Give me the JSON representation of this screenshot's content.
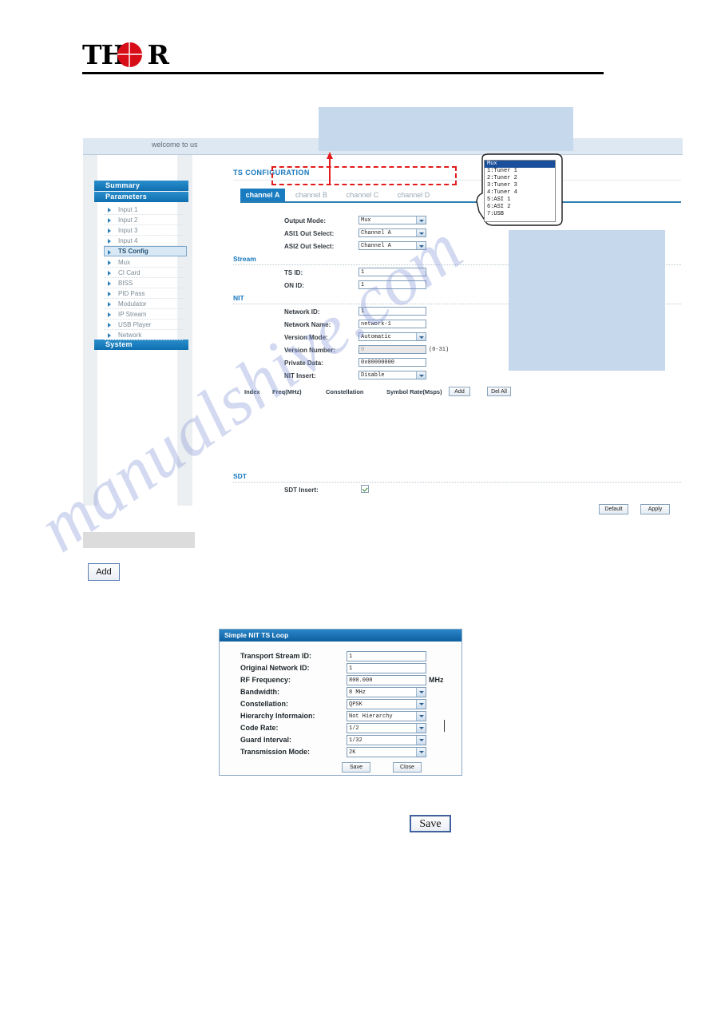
{
  "logo": {
    "text_left": "TH",
    "text_right": "R",
    "globe_icon": "globe-icon"
  },
  "window": {
    "welcome_text": "welcome to us"
  },
  "sidebar": {
    "headers": [
      {
        "label": "Summary"
      },
      {
        "label": "Parameters"
      },
      {
        "label": "System"
      }
    ],
    "items": [
      {
        "label": "Input 1"
      },
      {
        "label": "Input 2"
      },
      {
        "label": "Input 3"
      },
      {
        "label": "Input 4"
      },
      {
        "label": "TS Config"
      },
      {
        "label": "Mux"
      },
      {
        "label": "CI Card"
      },
      {
        "label": "BISS"
      },
      {
        "label": "PID Pass"
      },
      {
        "label": "Modulator"
      },
      {
        "label": "IP Stream"
      },
      {
        "label": "USB Player"
      },
      {
        "label": "Network"
      }
    ],
    "active_item": "TS Config"
  },
  "main": {
    "page_title": "TS CONFIGURATION",
    "tabs": [
      {
        "label": "channel A",
        "active": true
      },
      {
        "label": "channel B",
        "active": false
      },
      {
        "label": "channel C",
        "active": false
      },
      {
        "label": "channel D",
        "active": false
      }
    ],
    "output": {
      "output_mode_label": "Output Mode:",
      "output_mode_value": "Mux",
      "asi1_label": "ASI1 Out Select:",
      "asi1_value": "Channel A",
      "asi2_label": "ASI2 Out Select:",
      "asi2_value": "Channel A"
    },
    "stream": {
      "section": "Stream",
      "ts_id_label": "TS ID:",
      "ts_id_value": "1",
      "on_id_label": "ON ID:",
      "on_id_value": "1"
    },
    "nit": {
      "section": "NIT",
      "network_id_label": "Network ID:",
      "network_id_value": "1",
      "network_name_label": "Network Name:",
      "network_name_value": "network-1",
      "version_mode_label": "Version Mode:",
      "version_mode_value": "Automatic",
      "version_number_label": "Version Number:",
      "version_number_value": "0",
      "version_number_hint": "(0-31)",
      "private_data_label": "Private Data:",
      "private_data_value": "0x00000000",
      "nit_insert_label": "NIT Insert:",
      "nit_insert_value": "Disable"
    },
    "nit_table": {
      "columns": [
        "Index",
        "Freq(MHz)",
        "Constellation",
        "Symbol Rate(Msps)"
      ],
      "add_button": "Add",
      "delall_button": "Del All",
      "rows": []
    },
    "sdt": {
      "section": "SDT",
      "sdt_insert_label": "SDT Insert:",
      "sdt_insert_checked": true
    },
    "footer": {
      "default_button": "Default",
      "apply_button": "Apply"
    }
  },
  "dropdown_callout": {
    "options": [
      {
        "label": "Mux",
        "selected": true
      },
      {
        "label": "1:Tuner 1",
        "selected": false
      },
      {
        "label": "2:Tuner 2",
        "selected": false
      },
      {
        "label": "3:Tuner 3",
        "selected": false
      },
      {
        "label": "4:Tuner 4",
        "selected": false
      },
      {
        "label": "5:ASI 1",
        "selected": false
      },
      {
        "label": "6:ASI 2",
        "selected": false
      },
      {
        "label": "7:USB",
        "selected": false
      }
    ]
  },
  "standalone": {
    "add_button": "Add",
    "save_button": "Save"
  },
  "dialog": {
    "title": "Simple NIT TS Loop",
    "fields": [
      {
        "label": "Transport Stream ID:",
        "value": "1",
        "type": "text"
      },
      {
        "label": "Original Network ID:",
        "value": "1",
        "type": "text"
      },
      {
        "label": "RF Frequency:",
        "value": "800.000",
        "type": "text",
        "unit": "MHz"
      },
      {
        "label": "Bandwidth:",
        "value": "8 MHz",
        "type": "select"
      },
      {
        "label": "Constellation:",
        "value": "QPSK",
        "type": "select"
      },
      {
        "label": "Hierarchy Informaion:",
        "value": "Not Hierarchy",
        "type": "select"
      },
      {
        "label": "Code Rate:",
        "value": "1/2",
        "type": "select"
      },
      {
        "label": "Guard Interval:",
        "value": "1/32",
        "type": "select"
      },
      {
        "label": "Transmission Mode:",
        "value": "2K",
        "type": "select"
      }
    ],
    "save_button": "Save",
    "close_button": "Close"
  },
  "watermark": {
    "text": "manualshive.com"
  },
  "colors": {
    "brand_blue": "#1577bd",
    "header_blue": "#1a7fc1",
    "annotation_red": "#e21c1c",
    "annotation_blue": "#c6d8ec",
    "logo_red": "#d70d17"
  }
}
